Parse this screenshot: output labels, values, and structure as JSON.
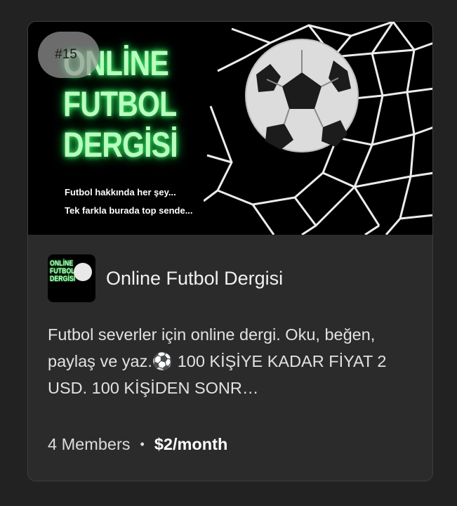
{
  "card": {
    "rank": "#15",
    "banner": {
      "title": "ONLİNE\nFUTBOL\nDERGİSİ",
      "tagline_1": "Futbol hakkında her şey...",
      "tagline_2": "Tek farkla burada top sende..."
    },
    "avatar_title": "ONLİNE\nFUTBOL\nDERGİSİ",
    "channel_name": "Online Futbol Dergisi",
    "description": "Futbol severler için online dergi. Oku, beğen, paylaş ve yaz.⚽️ 100 KİŞİYE KADAR FİYAT 2 USD. 100 KİŞİDEN SONR…",
    "members": "4 Members",
    "separator": "•",
    "price": "$2/month"
  },
  "colors": {
    "background": "#222222",
    "card": "#2b2b2b",
    "neon_green": "#b9ffbf"
  }
}
